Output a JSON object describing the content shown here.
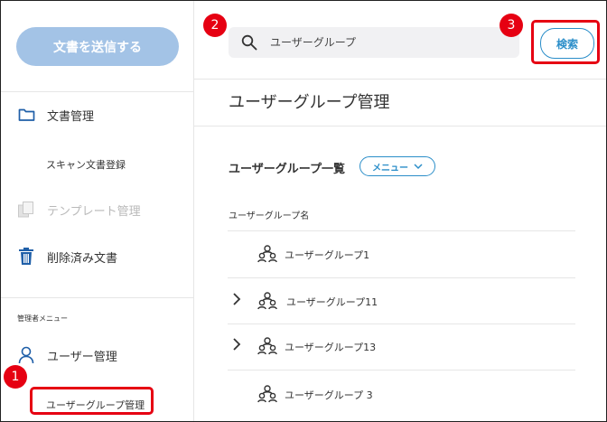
{
  "sidebar": {
    "send_button": "文書を送信する",
    "items": [
      {
        "label": "文書管理",
        "icon": "folder-icon"
      },
      {
        "label": "スキャン文書登録"
      },
      {
        "label": "テンプレート管理",
        "icon": "template-icon",
        "disabled": true
      },
      {
        "label": "削除済み文書",
        "icon": "trash-icon"
      }
    ],
    "admin_section_label": "管理者メニュー",
    "admin_items": [
      {
        "label": "ユーザー管理",
        "icon": "user-icon"
      },
      {
        "label": "ユーザーグループ管理"
      }
    ]
  },
  "header": {
    "search_placeholder": "ユーザーグループ",
    "search_button": "検索"
  },
  "main": {
    "page_title": "ユーザーグループ管理",
    "list_title": "ユーザーグループ一覧",
    "menu_button": "メニュー",
    "column_header": "ユーザーグループ名",
    "rows": [
      {
        "name": "ユーザーグループ1",
        "expandable": false
      },
      {
        "name": "ユーザーグループ11",
        "expandable": true
      },
      {
        "name": "ユーザーグループ13",
        "expandable": true
      },
      {
        "name": "ユーザーグループ 3",
        "expandable": false
      }
    ]
  },
  "callouts": [
    "1",
    "2",
    "3"
  ],
  "colors": {
    "accent": "#2b8ec9",
    "send_button_bg": "#a3c3e6",
    "callout": "#e60012"
  }
}
